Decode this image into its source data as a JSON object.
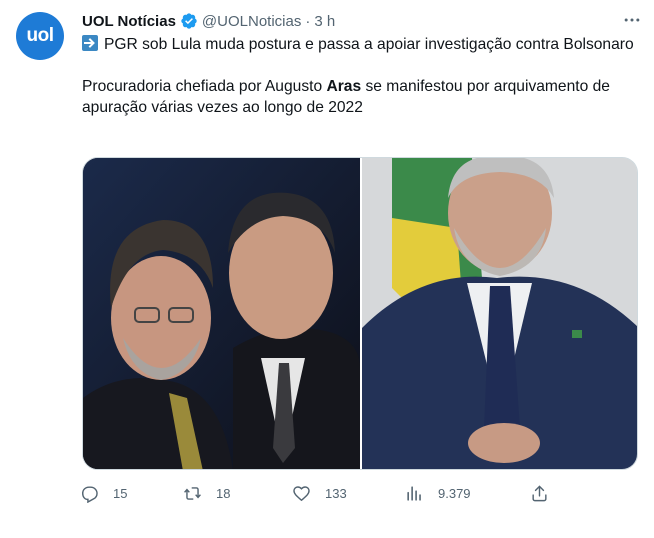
{
  "tweet": {
    "avatar_text": "uol",
    "author_name": "UOL Notícias",
    "handle": "@UOLNoticias",
    "separator": "·",
    "time": "3 h",
    "line1": "PGR sob Lula muda postura e passa a apoiar investigação contra Bolsonaro",
    "line2_before": "Procuradoria chefiada por Augusto ",
    "line2_bold": "Aras",
    "line2_after": " se manifestou por arquivamento de apuração várias vezes ao longo de 2022",
    "lead_icon": "arrow-right-icon"
  },
  "actions": {
    "replies": "15",
    "retweets": "18",
    "likes": "133",
    "views": "9.379"
  },
  "colors": {
    "brand_blue": "#1e7bd6",
    "verified_blue": "#1d9bf0",
    "muted_text": "#536471"
  }
}
